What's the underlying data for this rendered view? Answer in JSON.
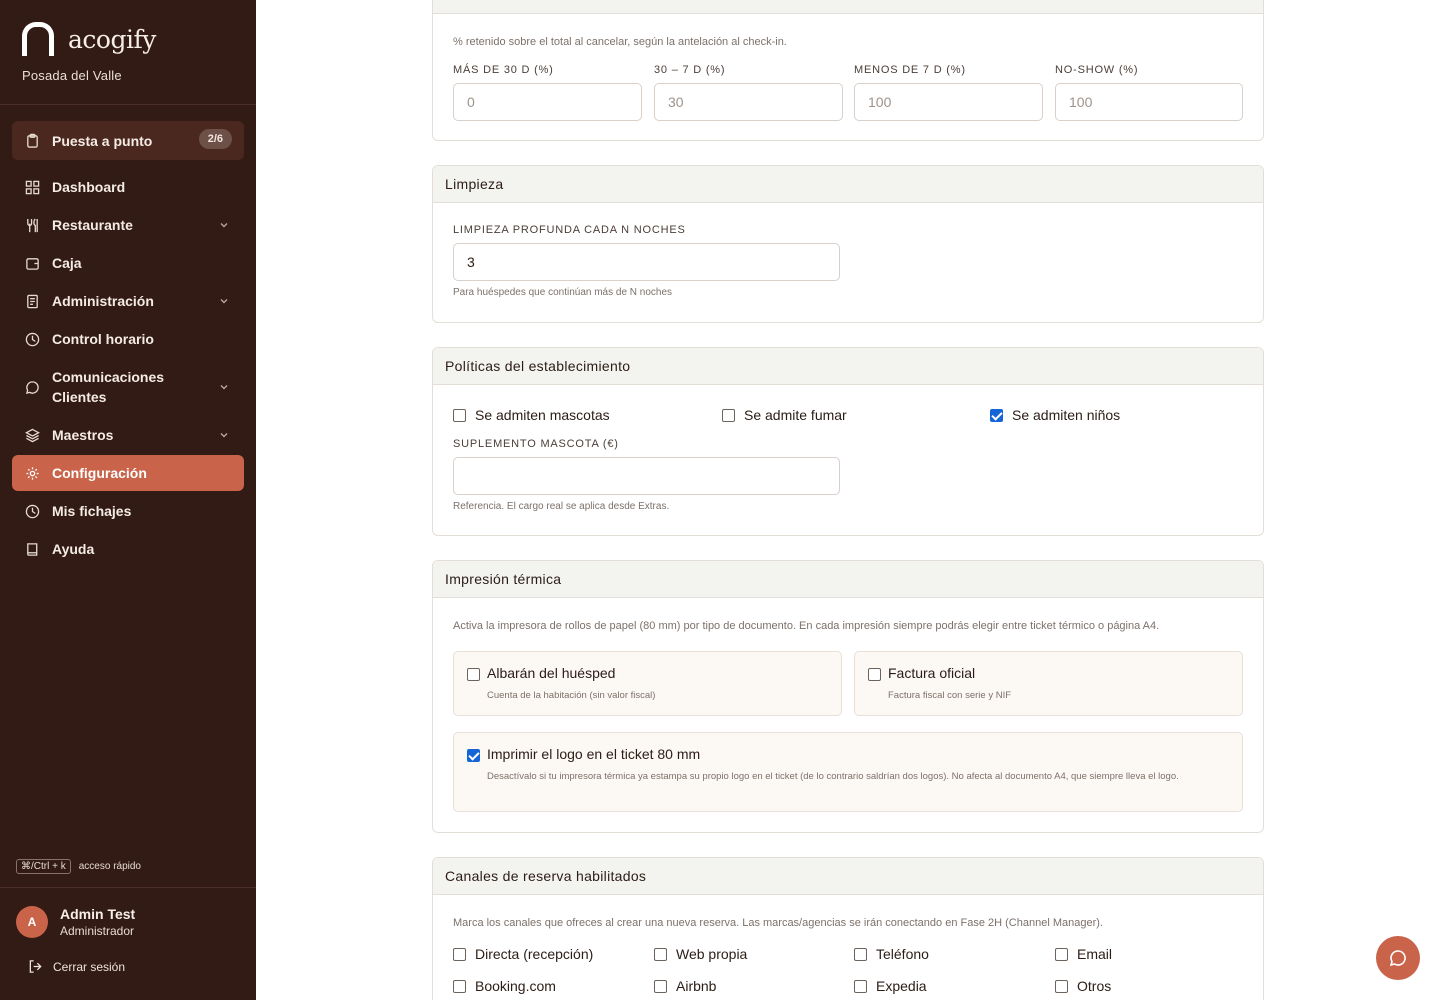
{
  "sidebar": {
    "brand": "acogify",
    "property": "Posada del Valle",
    "setup": {
      "label": "Puesta a punto",
      "badge": "2/6"
    },
    "items": [
      {
        "label": "Dashboard"
      },
      {
        "label": "Restaurante"
      },
      {
        "label": "Caja"
      },
      {
        "label": "Administración"
      },
      {
        "label": "Control horario"
      },
      {
        "label": "Comunicaciones Clientes"
      },
      {
        "label": "Maestros"
      },
      {
        "label": "Configuración"
      },
      {
        "label": "Mis fichajes"
      },
      {
        "label": "Ayuda"
      }
    ],
    "shortcut": {
      "key": "⌘/Ctrl + k",
      "label": "acceso rápido"
    },
    "user": {
      "initial": "A",
      "name": "Admin Test",
      "role": "Administrador"
    },
    "logout": "Cerrar sesión"
  },
  "cancellation": {
    "description": "% retenido sobre el total al cancelar, según la antelación al check-in.",
    "fields": [
      {
        "label": "MÁS DE 30 D (%)",
        "placeholder": "0"
      },
      {
        "label": "30 – 7 D (%)",
        "placeholder": "30"
      },
      {
        "label": "MENOS DE 7 D (%)",
        "placeholder": "100"
      },
      {
        "label": "NO-SHOW (%)",
        "placeholder": "100"
      }
    ]
  },
  "cleaning": {
    "title": "Limpieza",
    "field_label": "LIMPIEZA PROFUNDA CADA N NOCHES",
    "value": "3",
    "hint": "Para huéspedes que continúan más de N noches"
  },
  "policies": {
    "title": "Políticas del establecimiento",
    "pets": {
      "label": "Se admiten mascotas",
      "checked": false
    },
    "smoking": {
      "label": "Se admite fumar",
      "checked": false
    },
    "children": {
      "label": "Se admiten niños",
      "checked": true
    },
    "pet_fee_label": "SUPLEMENTO MASCOTA (€)",
    "pet_fee_value": "",
    "pet_fee_hint": "Referencia. El cargo real se aplica desde Extras."
  },
  "thermal": {
    "title": "Impresión térmica",
    "description": "Activa la impresora de rollos de papel (80 mm) por tipo de documento. En cada impresión siempre podrás elegir entre ticket térmico o página A4.",
    "guest_note": {
      "title": "Albarán del huésped",
      "sub": "Cuenta de la habitación (sin valor fiscal)",
      "checked": false
    },
    "invoice": {
      "title": "Factura oficial",
      "sub": "Factura fiscal con serie y NIF",
      "checked": false
    },
    "logo": {
      "title": "Imprimir el logo en el ticket 80 mm",
      "sub": "Desactívalo si tu impresora térmica ya estampa su propio logo en el ticket (de lo contrario saldrían dos logos). No afecta al documento A4, que siempre lleva el logo.",
      "checked": true
    }
  },
  "channels": {
    "title": "Canales de reserva habilitados",
    "description": "Marca los canales que ofreces al crear una nueva reserva. Las marcas/agencias se irán conectando en Fase 2H (Channel Manager).",
    "options": [
      {
        "label": "Directa (recepción)",
        "checked": false
      },
      {
        "label": "Web propia",
        "checked": false
      },
      {
        "label": "Teléfono",
        "checked": false
      },
      {
        "label": "Email",
        "checked": false
      },
      {
        "label": "Booking.com",
        "checked": false
      },
      {
        "label": "Airbnb",
        "checked": false
      },
      {
        "label": "Expedia",
        "checked": false
      },
      {
        "label": "Otros",
        "checked": false
      }
    ]
  },
  "colors": {
    "sidebar": "#321a15",
    "accent": "#c9644a",
    "checkbox": "#1565d8"
  }
}
